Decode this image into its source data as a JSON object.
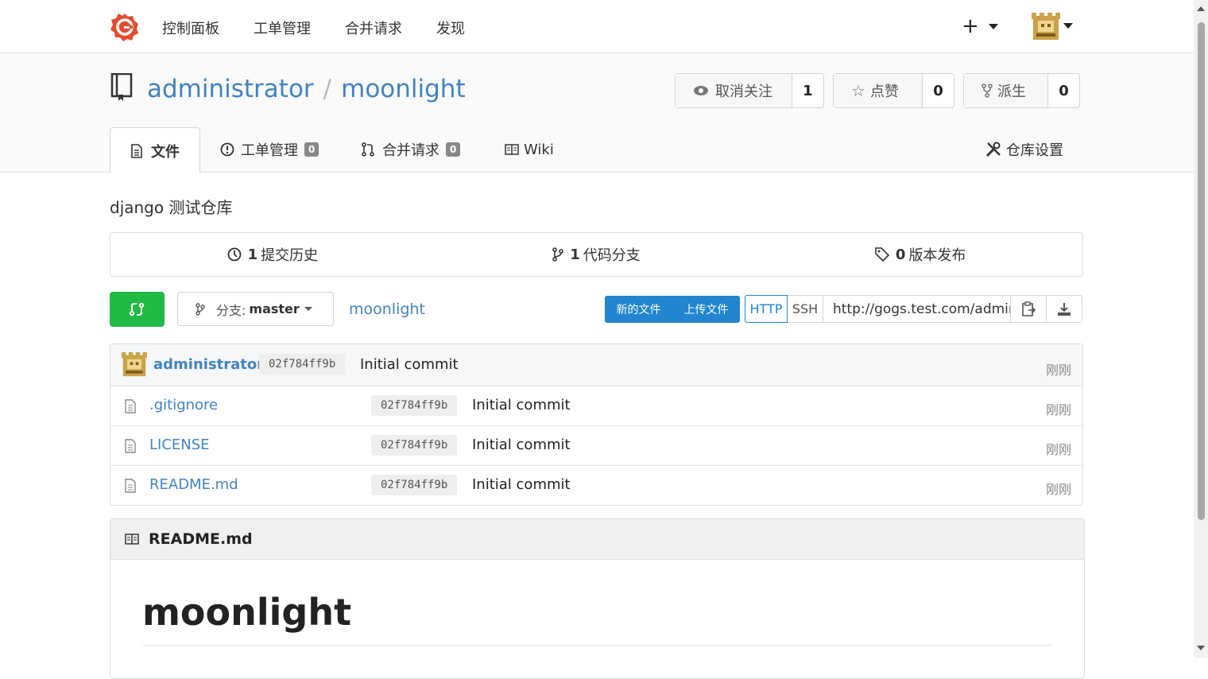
{
  "nav": {
    "items": [
      "控制面板",
      "工单管理",
      "合并请求",
      "发现"
    ],
    "plus": "+",
    "brand_color": "#e64a2e"
  },
  "repo": {
    "owner": "administrator",
    "separator": "/",
    "name": "moonlight",
    "watch_label": "取消关注",
    "watch_count": "1",
    "star_label": "点赞",
    "star_count": "0",
    "fork_label": "派生",
    "fork_count": "0"
  },
  "tabs": {
    "files": "文件",
    "issues": "工单管理",
    "issues_count": "0",
    "pulls": "合并请求",
    "pulls_count": "0",
    "wiki": "Wiki",
    "settings": "仓库设置"
  },
  "description": "django 测试仓库",
  "stats": {
    "commits_num": "1",
    "commits_label": "提交历史",
    "branches_num": "1",
    "branches_label": "代码分支",
    "releases_num": "0",
    "releases_label": "版本发布"
  },
  "toolbar": {
    "branch_prefix": "分支:",
    "branch_name": "master",
    "breadcrumb": "moonlight",
    "new_file": "新的文件",
    "upload_file": "上传文件",
    "http": "HTTP",
    "ssh": "SSH",
    "clone_url": "http://gogs.test.com/administrator/moonlight.git"
  },
  "latest_commit": {
    "author": "administrator",
    "sha": "02f784ff9b",
    "message": "Initial commit",
    "time": "刚刚"
  },
  "files": [
    {
      "name": ".gitignore",
      "sha": "02f784ff9b",
      "message": "Initial commit",
      "time": "刚刚"
    },
    {
      "name": "LICENSE",
      "sha": "02f784ff9b",
      "message": "Initial commit",
      "time": "刚刚"
    },
    {
      "name": "README.md",
      "sha": "02f784ff9b",
      "message": "Initial commit",
      "time": "刚刚"
    }
  ],
  "readme": {
    "filename": "README.md",
    "heading": "moonlight"
  }
}
